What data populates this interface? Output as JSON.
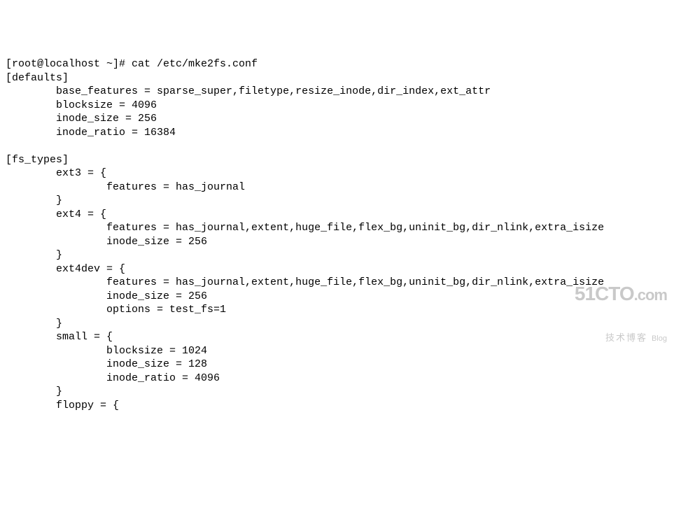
{
  "terminal": {
    "prompt_line": "[root@localhost ~]# cat /etc/mke2fs.conf",
    "section_defaults": "[defaults]",
    "defaults": {
      "base_features": "        base_features = sparse_super,filetype,resize_inode,dir_index,ext_attr",
      "blocksize": "        blocksize = 4096",
      "inode_size": "        inode_size = 256",
      "inode_ratio": "        inode_ratio = 16384"
    },
    "section_fs_types": "[fs_types]",
    "fs_types": {
      "ext3_open": "        ext3 = {",
      "ext3_features": "                features = has_journal",
      "ext3_close": "        }",
      "ext4_open": "        ext4 = {",
      "ext4_features": "                features = has_journal,extent,huge_file,flex_bg,uninit_bg,dir_nlink,extra_isize",
      "ext4_inode_size": "                inode_size = 256",
      "ext4_close": "        }",
      "ext4dev_open": "        ext4dev = {",
      "ext4dev_features": "                features = has_journal,extent,huge_file,flex_bg,uninit_bg,dir_nlink,extra_isize",
      "ext4dev_inode_size": "                inode_size = 256",
      "ext4dev_options": "                options = test_fs=1",
      "ext4dev_close": "        }",
      "small_open": "        small = {",
      "small_blocksize": "                blocksize = 1024",
      "small_inode_size": "                inode_size = 128",
      "small_inode_ratio": "                inode_ratio = 4096",
      "small_close": "        }",
      "floppy_open": "        floppy = {"
    }
  },
  "watermark": {
    "main": "51CTO",
    "com": ".com",
    "sub": "技术博客",
    "blog": "Blog"
  }
}
